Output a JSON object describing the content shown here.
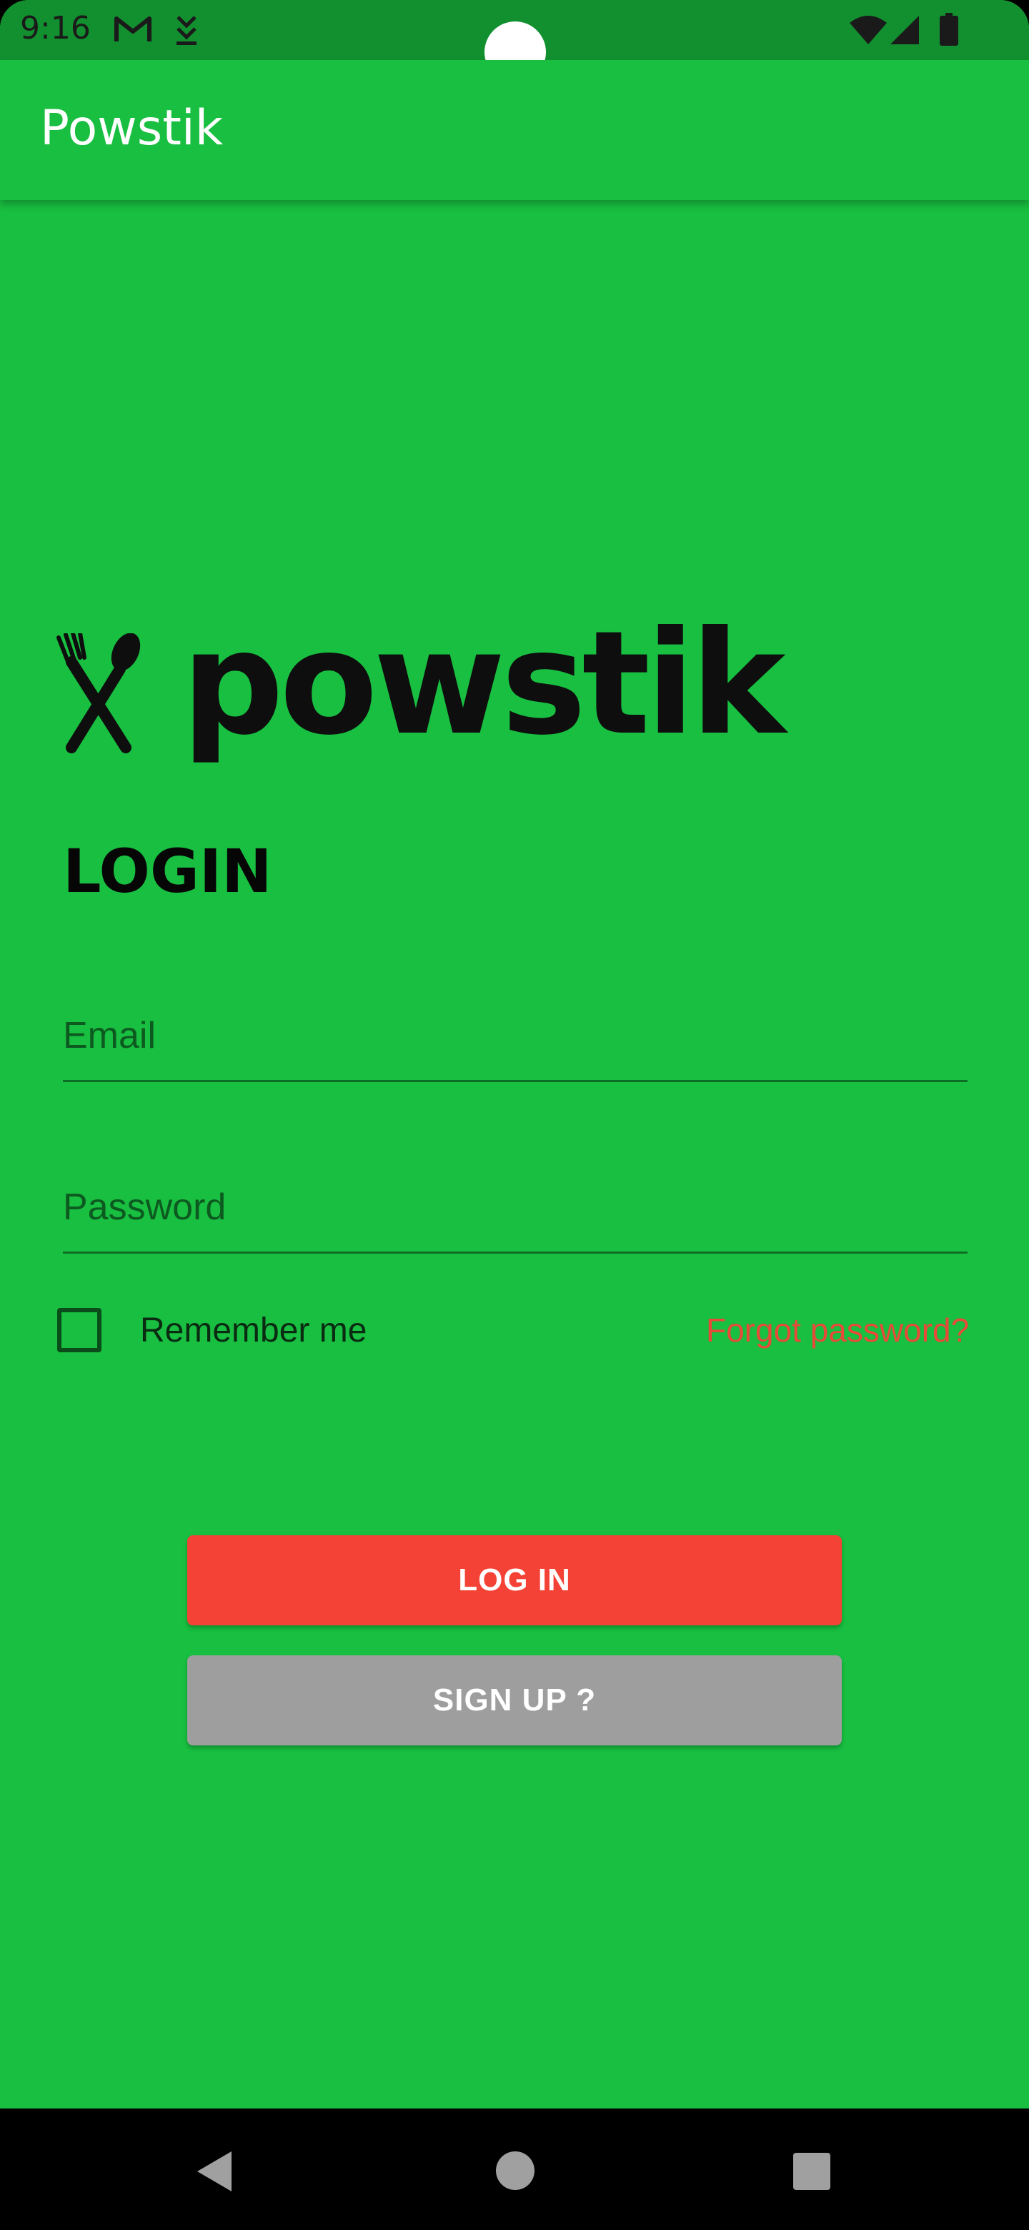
{
  "status_bar": {
    "time": "9:16",
    "icons": [
      "gmail-icon",
      "download-icon",
      "wifi-icon",
      "signal-icon",
      "battery-icon"
    ]
  },
  "app_bar": {
    "title": "Powstik"
  },
  "logo": {
    "text": "powstik",
    "icon": "fork-spoon-icon"
  },
  "login": {
    "heading": "LOGIN",
    "email_placeholder": "Email",
    "email_value": "",
    "password_placeholder": "Password",
    "password_value": "",
    "remember_label": "Remember me",
    "remember_checked": false,
    "forgot_label": "Forgot password?",
    "login_button": "LOG IN",
    "signup_button": "SIGN UP ?"
  },
  "nav_bar": {
    "icons": [
      "back-icon",
      "home-icon",
      "recents-icon"
    ]
  },
  "colors": {
    "background": "#18bf40",
    "status_bar": "#12902f",
    "login_button": "#f44336",
    "signup_button": "#9e9e9e",
    "forgot_link": "#e84a3a"
  }
}
